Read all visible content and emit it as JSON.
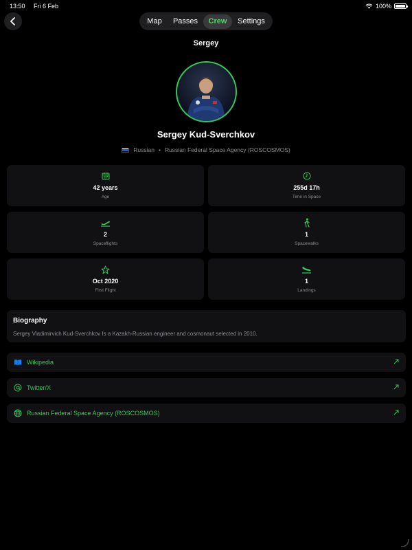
{
  "status": {
    "time": "13:50",
    "date": "Fri 6 Feb",
    "battery": "100%"
  },
  "tabs": [
    {
      "label": "Map"
    },
    {
      "label": "Passes"
    },
    {
      "label": "Crew",
      "active": true
    },
    {
      "label": "Settings"
    }
  ],
  "page_title": "Sergey",
  "profile": {
    "name": "Sergey Kud-Sverchkov",
    "nationality": "Russian",
    "separator": "•",
    "agency": "Russian Federal Space Agency (ROSCOSMOS)"
  },
  "stats": [
    {
      "icon": "calendar-icon",
      "value": "42 years",
      "label": "Age"
    },
    {
      "icon": "clock-icon",
      "value": "255d 17h",
      "label": "Time in Space"
    },
    {
      "icon": "airplane-takeoff-icon",
      "value": "2",
      "label": "Spaceflights"
    },
    {
      "icon": "walking-figure-icon",
      "value": "1",
      "label": "Spacewalks"
    },
    {
      "icon": "star-icon",
      "value": "Oct 2020",
      "label": "First Flight"
    },
    {
      "icon": "airplane-landing-icon",
      "value": "1",
      "label": "Landings"
    }
  ],
  "biography": {
    "title": "Biography",
    "text": "Sergey Vladimirvich Kud-Sverchkov Is a Kazakh-Russian engineer and cosmonaut selected in 2010."
  },
  "links": [
    {
      "icon": "book-icon",
      "label": "Wikipedia"
    },
    {
      "icon": "at-sign-icon",
      "label": "Twitter/X"
    },
    {
      "icon": "globe-icon",
      "label": "Russian Federal Space Agency (ROSCOSMOS)"
    }
  ],
  "colors": {
    "accent": "#34c759",
    "background": "#000000",
    "card": "#111113",
    "secondary_text": "#8e8e93",
    "link_icon_blue": "#0a84ff"
  }
}
